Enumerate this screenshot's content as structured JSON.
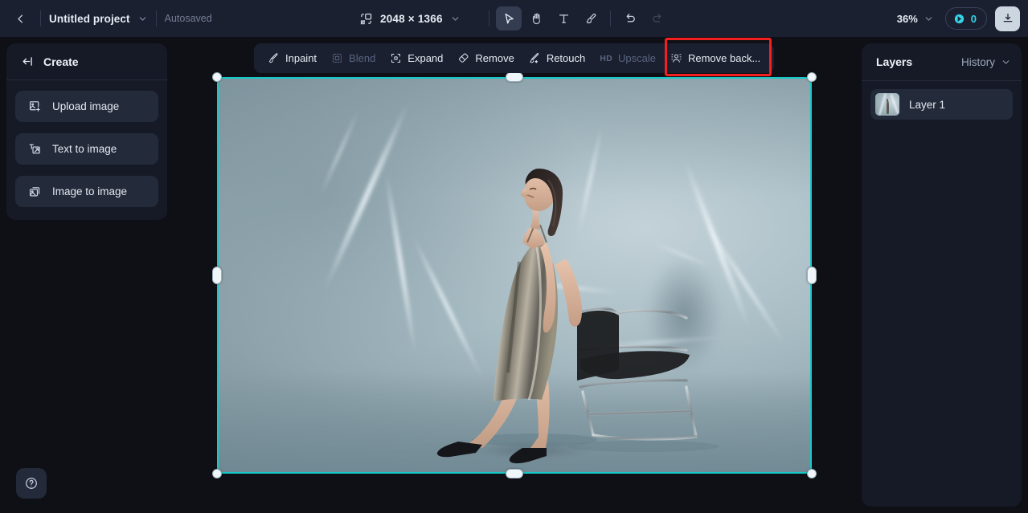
{
  "app": {
    "accent_cyan": "#16c8c8",
    "credit_cyan": "#35d2e8",
    "annotation_red": "#f41f1f",
    "topbar_bg": "#1b2030",
    "panel_bg": "#161a26",
    "canvas_bg": "#0e1016"
  },
  "topbar": {
    "back_icon": "chevron-left-icon",
    "project_title": "Untitled project",
    "project_caret_icon": "chevron-down-icon",
    "autosave_status": "Autosaved",
    "resize_icon": "resize-canvas-icon",
    "dimensions": "2048 × 1366",
    "dimensions_caret_icon": "chevron-down-icon",
    "tools": [
      {
        "name": "select-tool",
        "icon": "cursor-arrow-icon",
        "active": true,
        "disabled": false
      },
      {
        "name": "pan-tool",
        "icon": "hand-icon",
        "active": false,
        "disabled": false
      },
      {
        "name": "text-tool",
        "icon": "text-t-icon",
        "active": false,
        "disabled": false
      },
      {
        "name": "brush-tool",
        "icon": "brush-icon",
        "active": false,
        "disabled": false
      },
      {
        "name": "undo-button",
        "icon": "undo-arrow-icon",
        "active": false,
        "disabled": false
      },
      {
        "name": "redo-button",
        "icon": "redo-arrow-icon",
        "active": false,
        "disabled": true
      }
    ],
    "zoom_level": "36%",
    "zoom_caret_icon": "chevron-down-icon",
    "credits_icon": "credit-coin-icon",
    "credits_value": "0",
    "download_icon": "download-icon"
  },
  "sidebar": {
    "header_icon": "collapse-panel-icon",
    "header_label": "Create",
    "items": [
      {
        "label": "Upload image",
        "icon": "image-plus-icon"
      },
      {
        "label": "Text to image",
        "icon": "text-to-image-icon"
      },
      {
        "label": "Image to image",
        "icon": "image-to-image-icon"
      }
    ]
  },
  "help": {
    "icon": "help-circle-icon",
    "label": "?"
  },
  "action_toolbar": {
    "items": [
      {
        "label": "Inpaint",
        "icon": "inpaint-wand-icon",
        "disabled": false,
        "highlighted": false,
        "badge": ""
      },
      {
        "label": "Blend",
        "icon": "blend-icon",
        "disabled": true,
        "highlighted": false,
        "badge": ""
      },
      {
        "label": "Expand",
        "icon": "expand-frame-icon",
        "disabled": false,
        "highlighted": false,
        "badge": ""
      },
      {
        "label": "Remove",
        "icon": "eraser-icon",
        "disabled": false,
        "highlighted": false,
        "badge": ""
      },
      {
        "label": "Retouch",
        "icon": "retouch-sparkle-icon",
        "disabled": false,
        "highlighted": false,
        "badge": ""
      },
      {
        "label": "Upscale",
        "icon": "upscale-icon",
        "disabled": true,
        "highlighted": false,
        "badge": "HD"
      },
      {
        "label": "Remove back...",
        "icon": "remove-background-icon",
        "disabled": false,
        "highlighted": true,
        "badge": ""
      }
    ]
  },
  "canvas": {
    "selection_border_color": "#16c8c8",
    "handles": [
      "top-left-handle",
      "top-center-handle",
      "top-right-handle",
      "middle-left-handle",
      "middle-right-handle",
      "bottom-left-handle",
      "bottom-center-handle",
      "bottom-right-handle"
    ],
    "artwork_alt": "Fashion photo: woman in metallic silver slip dress standing beside a black and chrome armchair, light-blue studio background with white light streaks"
  },
  "right_panel": {
    "title": "Layers",
    "history_label": "History",
    "history_caret_icon": "chevron-down-icon",
    "layers": [
      {
        "name": "Layer 1",
        "thumb": "layer-thumbnail"
      }
    ]
  }
}
